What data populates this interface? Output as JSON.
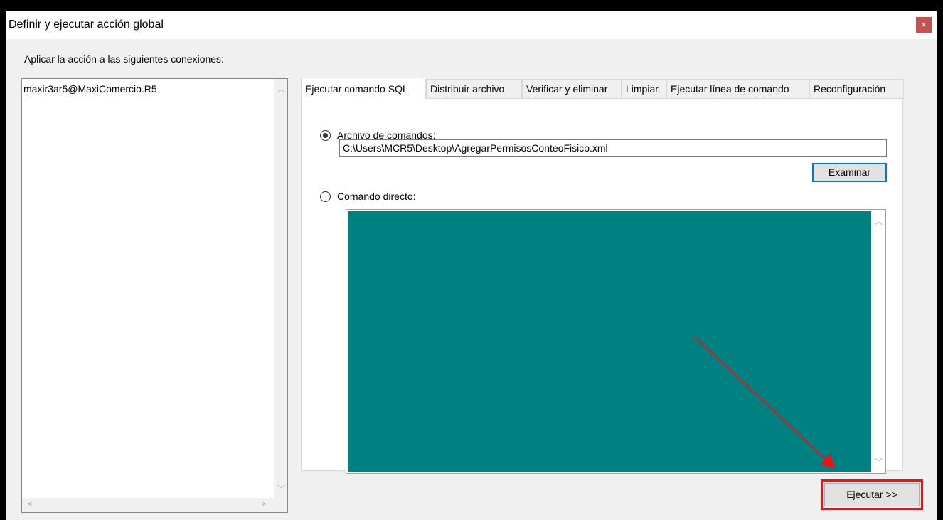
{
  "window": {
    "title": "Definir y ejecutar acción global",
    "close_glyph": "×"
  },
  "connections": {
    "label": "Aplicar la acción a las siguientes conexiones:",
    "items": [
      "maxir3ar5@MaxiComercio.R5"
    ]
  },
  "tabs": [
    {
      "label": "Ejecutar comando SQL",
      "active": true
    },
    {
      "label": "Distribuir archivo",
      "active": false
    },
    {
      "label": "Verificar y eliminar",
      "active": false
    },
    {
      "label": "Limpiar",
      "active": false
    },
    {
      "label": "Ejecutar línea de comando",
      "active": false
    },
    {
      "label": "Reconfiguración",
      "active": false
    }
  ],
  "sql_tab": {
    "file_option_label": "Archivo de comandos:",
    "file_option_selected": true,
    "file_path": "C:\\Users\\MCR5\\Desktop\\AgregarPermisosConteoFisico.xml",
    "browse_label": "Examinar",
    "direct_option_label": "Comando directo:",
    "direct_option_selected": false,
    "direct_command_value": ""
  },
  "execute_label": "Ejecutar >>",
  "colors": {
    "command_area": "#008080",
    "highlight": "#e8141a",
    "focus_border": "#0078d7",
    "close_button": "#c75050"
  }
}
